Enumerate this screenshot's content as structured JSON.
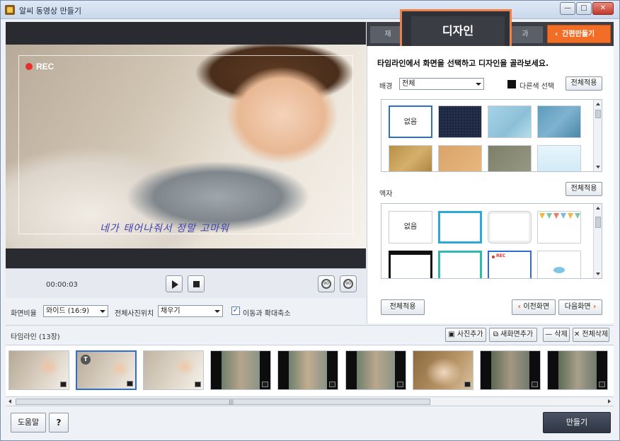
{
  "window": {
    "title": "알씨 동영상 만들기",
    "controls": {
      "minimize": "—",
      "maximize": "□",
      "close": "✕"
    }
  },
  "preview": {
    "rec_label": "REC",
    "caption": "네가 태어나줘서 정말 고마워",
    "timecode": "00:00:03"
  },
  "settings": {
    "aspect_label": "화면비율",
    "aspect_value": "와이드 (16:9)",
    "position_label": "전체사진위치",
    "position_value": "채우기",
    "zoom_checkbox_label": "이동과 확대축소",
    "zoom_checked": true
  },
  "tabs": {
    "left_partial": "재",
    "right_partial": "과",
    "active": "디자인",
    "quick": "간편만들기"
  },
  "design": {
    "instruction": "타임라인에서 화면을 선택하고 디자인을 골라보세요.",
    "background_label": "배경",
    "background_select": "전체",
    "other_color_label": "다른색 선택",
    "apply_all": "전체적용",
    "frame_label": "액자",
    "frame_apply_all": "전체적용",
    "none_label": "없음",
    "apply_all_bottom": "전체적용",
    "prev_screen": "이전화면",
    "next_screen": "다음화면"
  },
  "timeline": {
    "title": "타임라인 (13장)",
    "add_photo": "사진추가",
    "new_screen": "새화면추가",
    "delete": "삭제",
    "delete_all": "전체삭제",
    "first_frame_badge": "T"
  },
  "bottom": {
    "help": "도움말",
    "question": "?",
    "make": "만들기"
  },
  "colors": {
    "accent_orange": "#f26e27",
    "selection_blue": "#2d6fd0",
    "highlight_frame": "#f0804a"
  }
}
